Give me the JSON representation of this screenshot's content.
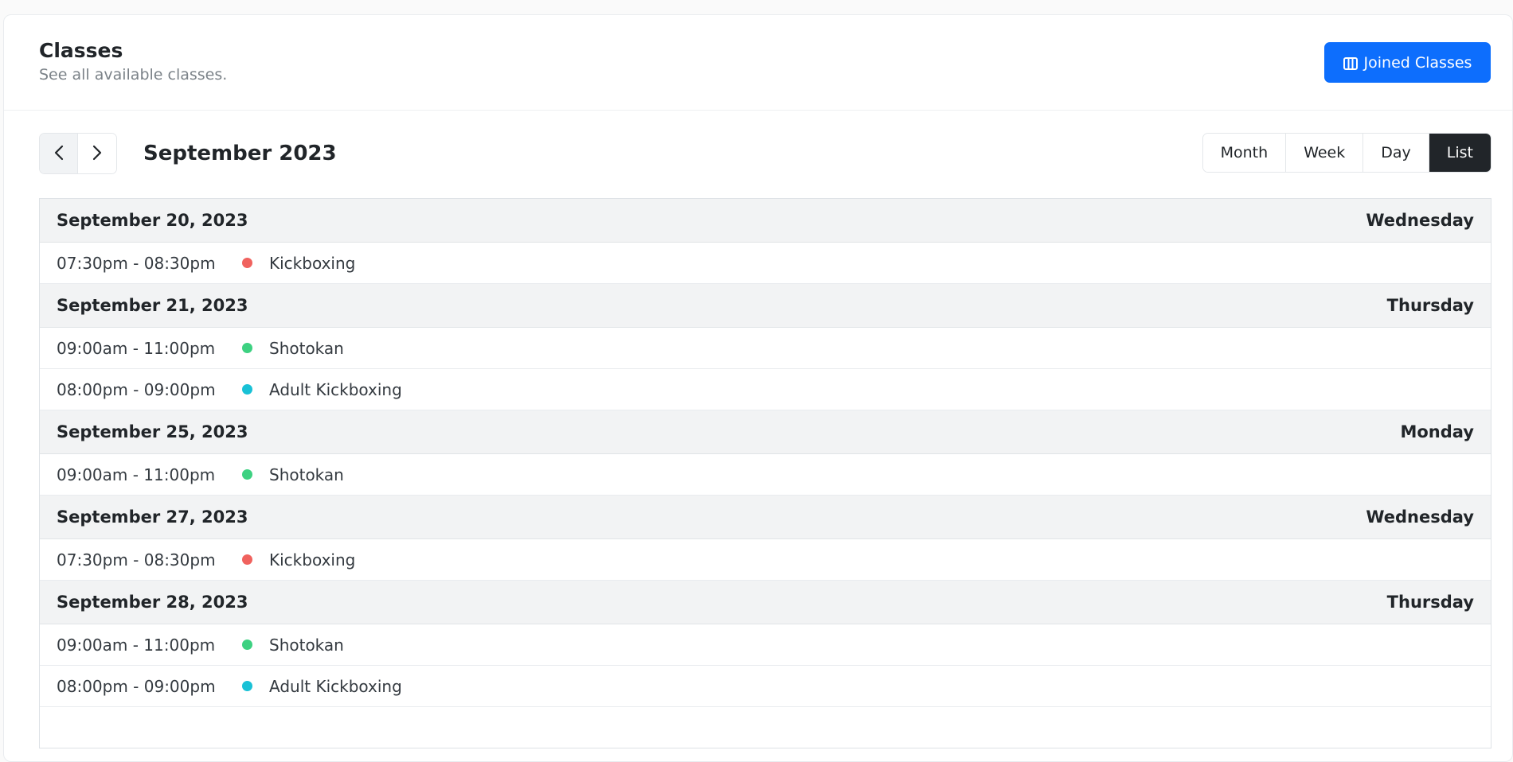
{
  "header": {
    "title": "Classes",
    "subtitle": "See all available classes.",
    "joined_button_label": "Joined Classes",
    "joined_button_icon": "columns-icon"
  },
  "toolbar": {
    "prev_icon": "chevron-left-icon",
    "next_icon": "chevron-right-icon",
    "title": "September 2023",
    "views": [
      "Month",
      "Week",
      "Day",
      "List"
    ],
    "active_view": "List"
  },
  "colors": {
    "primary": "#0d6efd",
    "dark": "#212529",
    "kickboxing": "#f0625e",
    "shotokan": "#3dd181",
    "adult_kickboxing": "#19c1d6"
  },
  "days": [
    {
      "date": "September 20, 2023",
      "weekday": "Wednesday",
      "events": [
        {
          "time": "07:30pm - 08:30pm",
          "name": "Kickboxing",
          "color": "#f0625e"
        }
      ]
    },
    {
      "date": "September 21, 2023",
      "weekday": "Thursday",
      "events": [
        {
          "time": "09:00am - 11:00pm",
          "name": "Shotokan",
          "color": "#3dd181"
        },
        {
          "time": "08:00pm - 09:00pm",
          "name": "Adult Kickboxing",
          "color": "#19c1d6"
        }
      ]
    },
    {
      "date": "September 25, 2023",
      "weekday": "Monday",
      "events": [
        {
          "time": "09:00am - 11:00pm",
          "name": "Shotokan",
          "color": "#3dd181"
        }
      ]
    },
    {
      "date": "September 27, 2023",
      "weekday": "Wednesday",
      "events": [
        {
          "time": "07:30pm - 08:30pm",
          "name": "Kickboxing",
          "color": "#f0625e"
        }
      ]
    },
    {
      "date": "September 28, 2023",
      "weekday": "Thursday",
      "events": [
        {
          "time": "09:00am - 11:00pm",
          "name": "Shotokan",
          "color": "#3dd181"
        },
        {
          "time": "08:00pm - 09:00pm",
          "name": "Adult Kickboxing",
          "color": "#19c1d6"
        }
      ]
    }
  ]
}
